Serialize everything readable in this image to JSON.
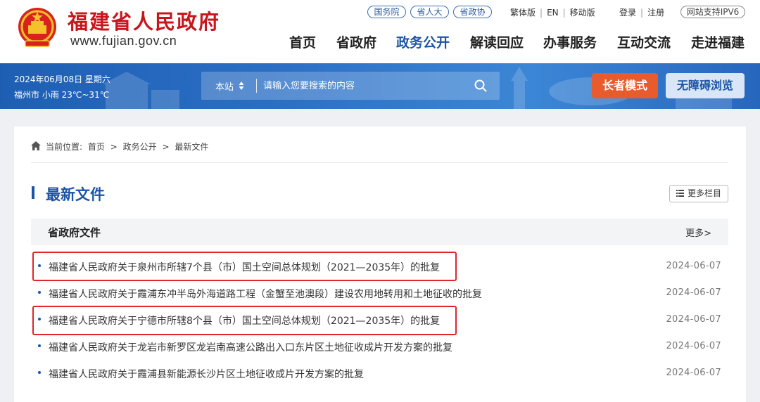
{
  "header": {
    "site_name": "福建省人民政府",
    "site_url": "www.fujian.gov.cn",
    "org_links": [
      "国务院",
      "省人大",
      "省政协"
    ],
    "lang_links": [
      "繁体版",
      "EN",
      "移动版"
    ],
    "account_links": [
      "登录",
      "注册"
    ],
    "ipv6_label": "网站支持IPV6",
    "nav": [
      {
        "label": "首页",
        "active": false
      },
      {
        "label": "省政府",
        "active": false
      },
      {
        "label": "政务公开",
        "active": true
      },
      {
        "label": "解读回应",
        "active": false
      },
      {
        "label": "办事服务",
        "active": false
      },
      {
        "label": "互动交流",
        "active": false
      },
      {
        "label": "走进福建",
        "active": false
      }
    ]
  },
  "banner": {
    "date": "2024年06月08日 星期六",
    "weather": "福州市 小雨 23℃~31℃",
    "search_scope": "本站",
    "search_placeholder": "请输入您要搜索的内容",
    "elder_mode": "长者模式",
    "accessibility": "无障碍浏览"
  },
  "breadcrumb": {
    "prefix": "当前位置:",
    "items": [
      "首页",
      "政务公开",
      "最新文件"
    ],
    "separator": ">"
  },
  "section": {
    "title": "最新文件",
    "more_columns": "更多栏目",
    "sub_title": "省政府文件",
    "sub_more": "更多>"
  },
  "documents": [
    {
      "title": "福建省人民政府关于泉州市所辖7个县（市）国土空间总体规划（2021—2035年）的批复",
      "date": "2024-06-07",
      "highlighted": true
    },
    {
      "title": "福建省人民政府关于霞浦东冲半岛外海道路工程（金蟹至池澳段）建设农用地转用和土地征收的批复",
      "date": "2024-06-07",
      "highlighted": false
    },
    {
      "title": "福建省人民政府关于宁德市所辖8个县（市）国土空间总体规划（2021—2035年）的批复",
      "date": "2024-06-07",
      "highlighted": true
    },
    {
      "title": "福建省人民政府关于龙岩市新罗区龙岩南高速公路出入口东片区土地征收成片开发方案的批复",
      "date": "2024-06-07",
      "highlighted": false
    },
    {
      "title": "福建省人民政府关于霞浦县新能源长沙片区土地征收成片开发方案的批复",
      "date": "2024-06-07",
      "highlighted": false
    }
  ],
  "colors": {
    "brand_red": "#c8161d",
    "brand_blue": "#1b54a5",
    "elder_orange": "#e85b2c",
    "highlight_red": "#e0252b"
  }
}
